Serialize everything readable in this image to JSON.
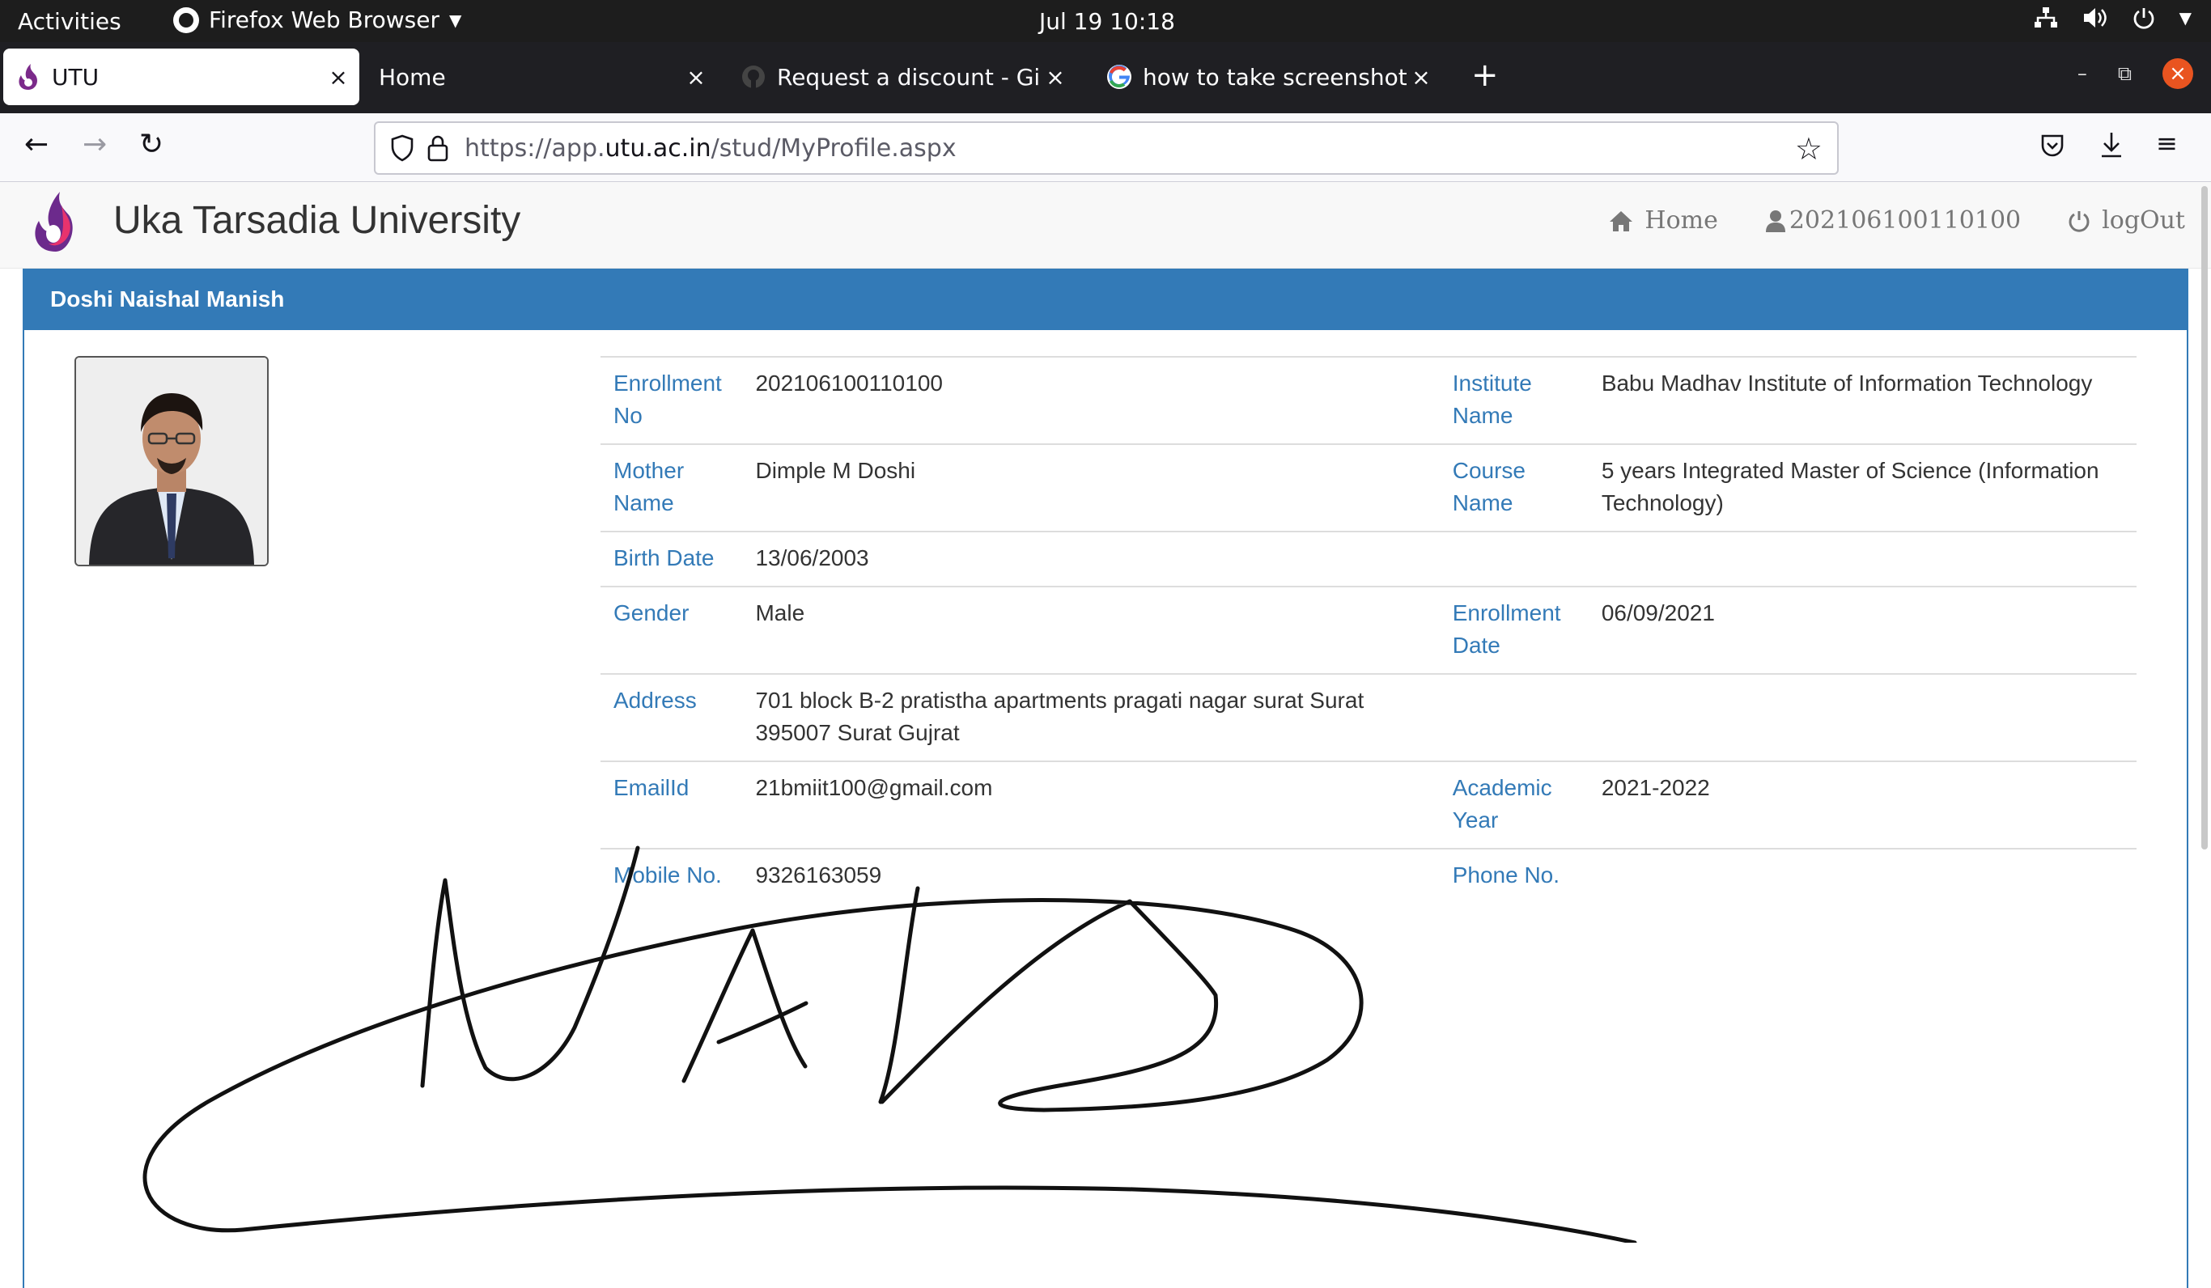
{
  "os_topbar": {
    "activities": "Activities",
    "app_name": "Firefox Web Browser",
    "clock": "Jul 19  10:18"
  },
  "tabs": [
    {
      "title": "UTU",
      "active": true
    },
    {
      "title": "Home",
      "active": false
    },
    {
      "title": "Request a discount - GitH",
      "active": false
    },
    {
      "title": "how to take screenshot in",
      "active": false
    }
  ],
  "address_bar": {
    "url_prefix": "https://app.",
    "url_domain": "utu.ac.in",
    "url_path": "/stud/MyProfile.aspx"
  },
  "site": {
    "brand": "Uka Tarsadia University",
    "nav": {
      "home": "Home",
      "user": "202106100110100",
      "logout": "logOut"
    }
  },
  "profile": {
    "student_name": "Doshi Naishal Manish",
    "rows": [
      {
        "l1": "Enrollment No",
        "v1": "202106100110100",
        "l2": "Institute Name",
        "v2": "Babu Madhav Institute of Information Technology"
      },
      {
        "l1": "Mother Name",
        "v1": "Dimple M Doshi",
        "l2": "Course Name",
        "v2": "5 years Integrated Master of Science (Information Technology)"
      },
      {
        "l1": "Birth Date",
        "v1": "13/06/2003",
        "l2": "",
        "v2": ""
      },
      {
        "l1": "Gender",
        "v1": "Male",
        "l2": "Enrollment Date",
        "v2": "06/09/2021"
      },
      {
        "l1": "Address",
        "v1": "701 block B-2 pratistha apartments pragati nagar surat Surat 395007 Surat Gujrat",
        "l2": "",
        "v2": ""
      },
      {
        "l1": "EmailId",
        "v1": "21bmiit100@gmail.com",
        "l2": "Academic Year",
        "v2": "2021-2022"
      },
      {
        "l1": "Mobile No.",
        "v1": "9326163059",
        "l2": "Phone No.",
        "v2": ""
      }
    ]
  },
  "colors": {
    "panel_blue": "#337ab7",
    "label_blue": "#337ab7",
    "os_bar": "#1d1d1d",
    "tab_strip": "#1f1f23",
    "close_orange": "#e95420"
  },
  "icons": [
    "firefox-icon",
    "utu-logo-icon",
    "github-icon",
    "google-icon",
    "close-icon",
    "plus-icon",
    "back-icon",
    "forward-icon",
    "reload-icon",
    "shield-icon",
    "lock-icon",
    "star-icon",
    "pocket-icon",
    "download-icon",
    "menu-icon",
    "home-icon",
    "user-icon",
    "power-icon",
    "network-icon",
    "volume-icon"
  ]
}
